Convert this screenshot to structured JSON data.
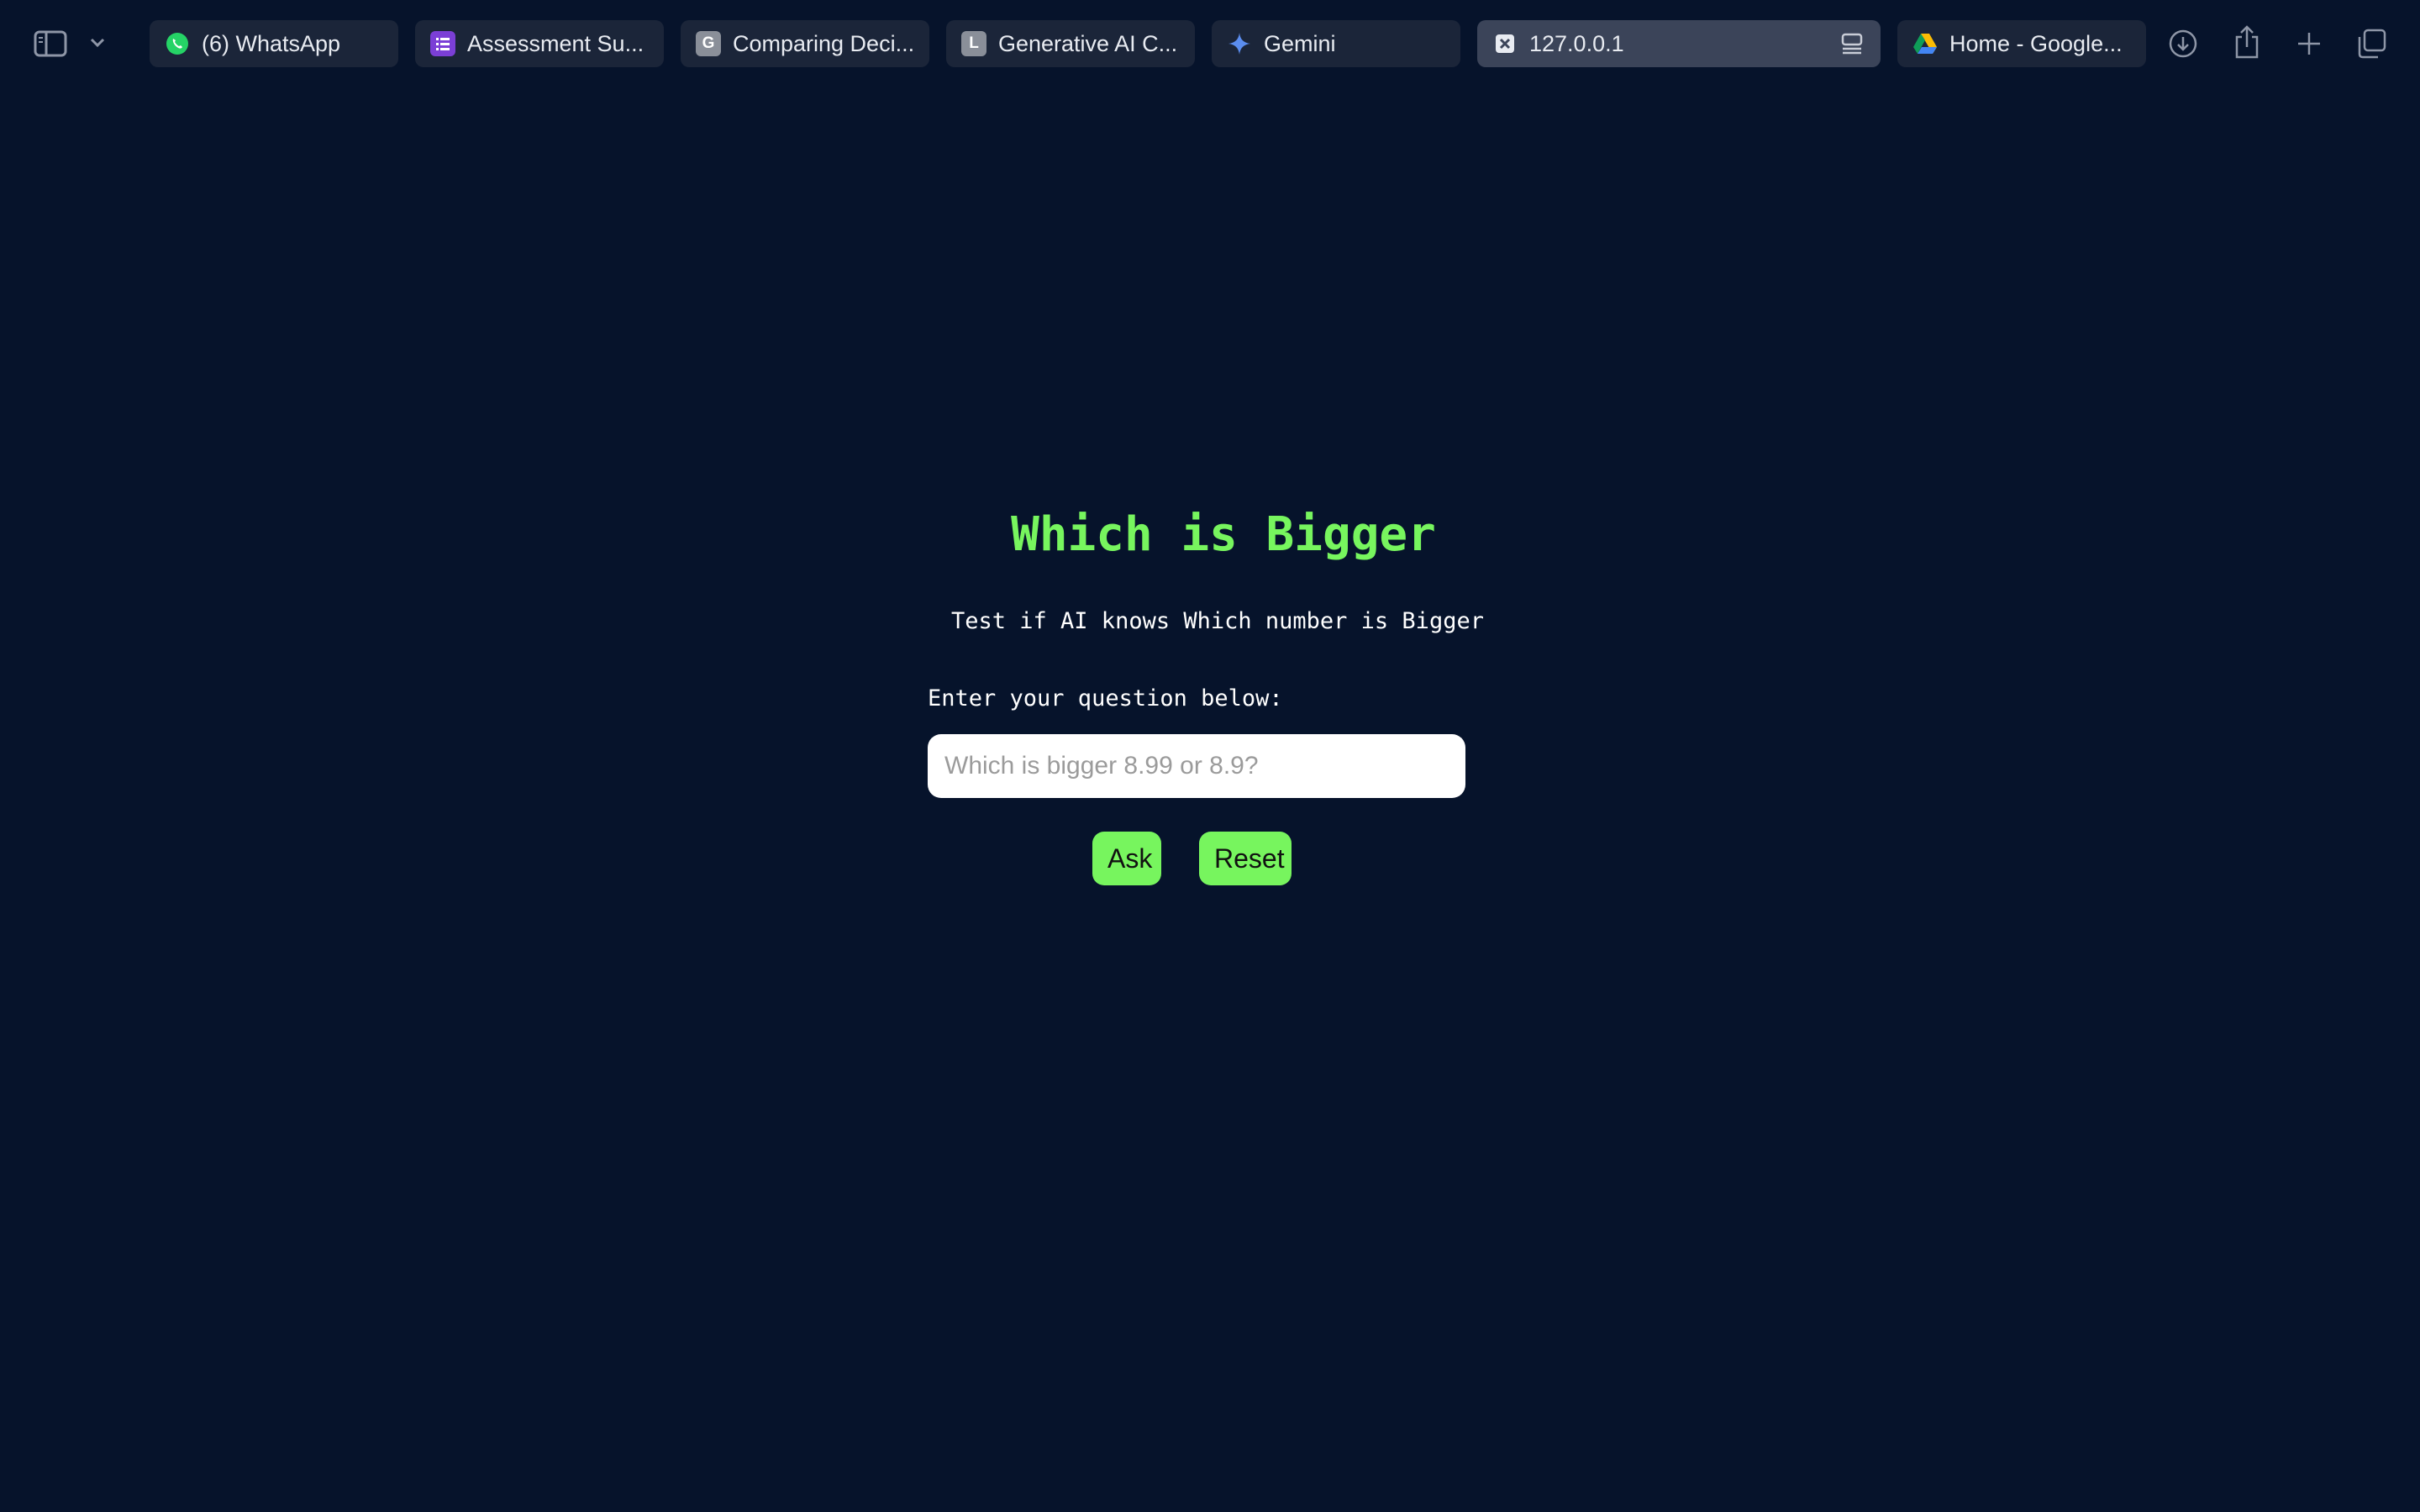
{
  "browser": {
    "tabs": [
      {
        "label": "(6) WhatsApp",
        "icon": "whatsapp-icon",
        "icon_color": "#25d366",
        "active": false
      },
      {
        "label": "Assessment Su...",
        "icon": "list-icon",
        "icon_color": "#7b3fd6",
        "active": false
      },
      {
        "label": "Comparing Deci...",
        "icon": "letter-g-icon",
        "icon_glyph": "G",
        "icon_color": "#8a8f99",
        "active": false
      },
      {
        "label": "Generative AI C...",
        "icon": "letter-l-icon",
        "icon_glyph": "L",
        "icon_color": "#8a8f99",
        "active": false
      },
      {
        "label": "Gemini",
        "icon": "gemini-sparkle-icon",
        "icon_color": "#5b8def",
        "active": false
      },
      {
        "label": "127.0.0.1",
        "icon": "close-box-icon",
        "active": true
      },
      {
        "label": "Home - Google...",
        "icon": "google-drive-icon",
        "active": false
      }
    ],
    "icons": {
      "sidebar": "sidebar-icon",
      "tab_group_menu": "chevron-down-icon",
      "reader": "reader-icon",
      "downloads": "download-icon",
      "share": "share-icon",
      "new_tab": "plus-icon",
      "tab_overview": "tab-overview-icon"
    }
  },
  "page": {
    "title": "Which is Bigger",
    "subtitle": "Test if AI knows Which number is Bigger",
    "prompt_label": "Enter your question below:",
    "input": {
      "value": "",
      "placeholder": "Which is bigger 8.99 or 8.9?"
    },
    "buttons": {
      "ask": "Ask",
      "reset": "Reset"
    }
  },
  "colors": {
    "background": "#06132b",
    "accent": "#77f55e",
    "tab": "#1b2539",
    "tab_active": "#3b4459"
  }
}
